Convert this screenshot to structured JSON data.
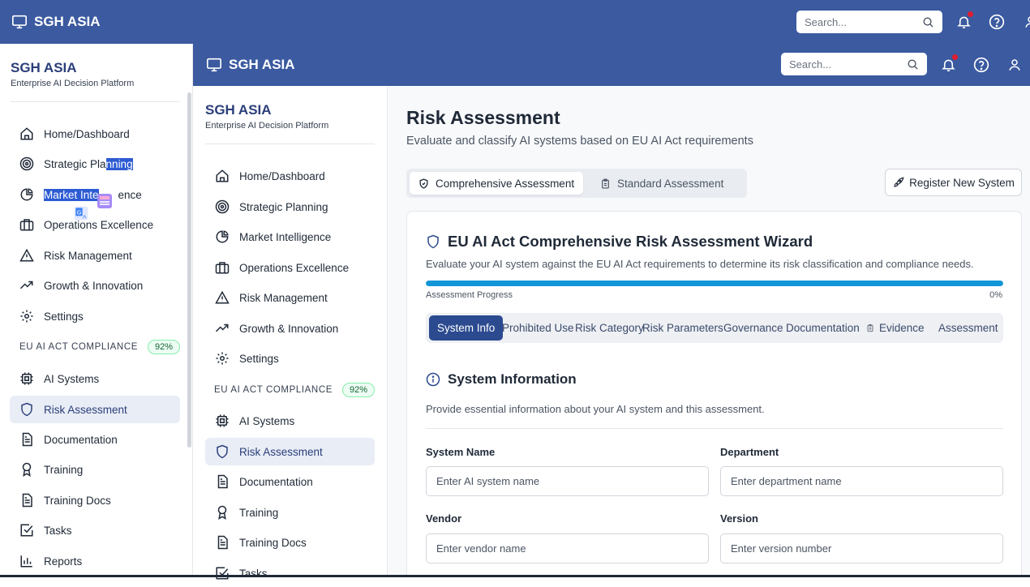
{
  "app": {
    "brand": "SGH ASIA",
    "subtitle": "Enterprise AI Decision Platform",
    "search_placeholder": "Search...",
    "colors": {
      "header": "#3b5aa0",
      "accent": "#2b4a8f",
      "progress": "#1296d8",
      "notification_dot": "#e11d2e"
    }
  },
  "outer_nav": {
    "items": [
      {
        "label": "Home/Dashboard",
        "icon": "home-icon"
      },
      {
        "label": "Strategic Planning",
        "icon": "target-icon"
      },
      {
        "label": "Market Intelligence",
        "icon": "pie-chart-icon"
      },
      {
        "label": "Operations Excellence",
        "icon": "briefcase-icon"
      },
      {
        "label": "Risk Management",
        "icon": "warning-icon"
      },
      {
        "label": "Growth & Innovation",
        "icon": "trending-up-icon"
      },
      {
        "label": "Settings",
        "icon": "gear-icon"
      }
    ],
    "section_label": "EU AI ACT COMPLIANCE",
    "section_badge": "92%",
    "compliance_items": [
      {
        "label": "AI Systems",
        "icon": "cpu-icon"
      },
      {
        "label": "Risk Assessment",
        "icon": "shield-icon"
      },
      {
        "label": "Documentation",
        "icon": "document-icon"
      },
      {
        "label": "Training",
        "icon": "award-icon"
      },
      {
        "label": "Training Docs",
        "icon": "document-icon"
      },
      {
        "label": "Tasks",
        "icon": "checkbox-icon"
      },
      {
        "label": "Reports",
        "icon": "bar-chart-icon"
      }
    ],
    "selection_a": "Strategic Pla",
    "selection_b": "nning",
    "selection_c": "Market Inte",
    "selection_d": "ence"
  },
  "inner_nav": {
    "items": [
      {
        "label": "Home/Dashboard"
      },
      {
        "label": "Strategic Planning"
      },
      {
        "label": "Market Intelligence"
      },
      {
        "label": "Operations Excellence"
      },
      {
        "label": "Risk Management"
      },
      {
        "label": "Growth & Innovation"
      },
      {
        "label": "Settings"
      }
    ],
    "section_label": "EU AI ACT COMPLIANCE",
    "section_badge": "92%",
    "compliance_items": [
      {
        "label": "AI Systems"
      },
      {
        "label": "Risk Assessment"
      },
      {
        "label": "Documentation"
      },
      {
        "label": "Training"
      },
      {
        "label": "Training Docs"
      },
      {
        "label": "Tasks"
      }
    ]
  },
  "main": {
    "title": "Risk Assessment",
    "subtitle": "Evaluate and classify AI systems based on EU AI Act requirements",
    "tabs": [
      {
        "label": "Comprehensive Assessment",
        "icon": "shield-check-icon",
        "active": true
      },
      {
        "label": "Standard Assessment",
        "icon": "clipboard-icon",
        "active": false
      }
    ],
    "register_button": "Register New System",
    "wizard": {
      "title": "EU AI Act Comprehensive Risk Assessment Wizard",
      "description": "Evaluate your AI system against the EU AI Act requirements to determine its risk classification and compliance needs.",
      "progress_label": "Assessment Progress",
      "progress_value": 0,
      "progress_text": "0%",
      "steps": [
        {
          "label": "System Info",
          "active": true
        },
        {
          "label": "Prohibited Use"
        },
        {
          "label": "Risk Category"
        },
        {
          "label": "Risk Parameters"
        },
        {
          "label": "Governance"
        },
        {
          "label": "Documentation"
        },
        {
          "label": "Evidence",
          "icon": "clipboard-icon"
        },
        {
          "label": "Assessment"
        }
      ],
      "section_title": "System Information",
      "section_description": "Provide essential information about your AI system and this assessment.",
      "fields": [
        {
          "label": "System Name",
          "placeholder": "Enter AI system name"
        },
        {
          "label": "Department",
          "placeholder": "Enter department name"
        },
        {
          "label": "Vendor",
          "placeholder": "Enter vendor name"
        },
        {
          "label": "Version",
          "placeholder": "Enter version number"
        }
      ]
    }
  }
}
